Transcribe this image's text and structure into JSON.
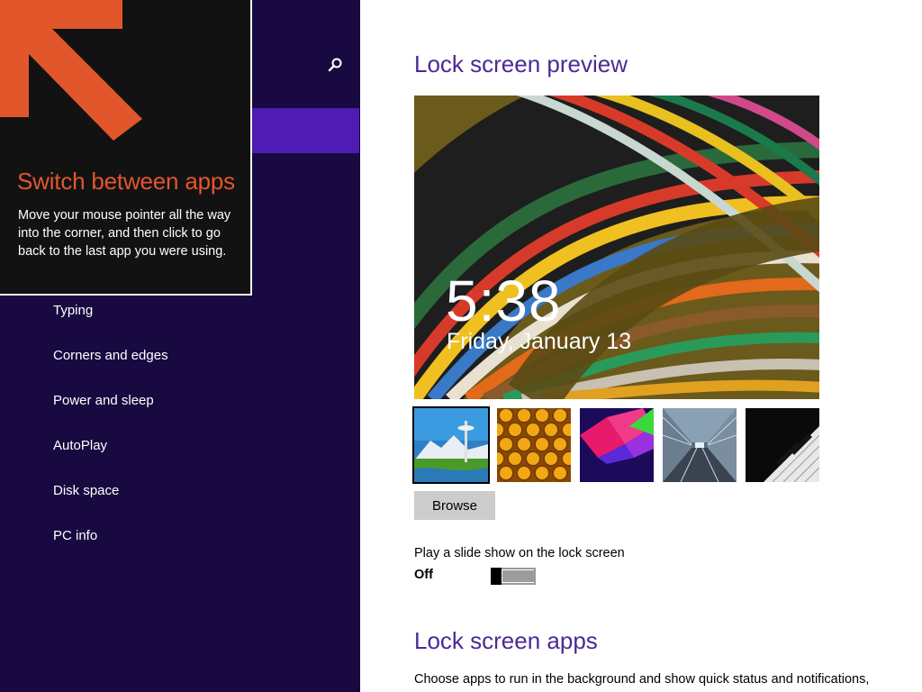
{
  "sidebar": {
    "search_icon": "search-icon",
    "items": [
      {
        "label": "Typing"
      },
      {
        "label": "Corners and edges"
      },
      {
        "label": "Power and sleep"
      },
      {
        "label": "AutoPlay"
      },
      {
        "label": "Disk space"
      },
      {
        "label": "PC info"
      }
    ]
  },
  "tip": {
    "title": "Switch between apps",
    "body": "Move your mouse pointer all the way into the corner, and then click to go back to the last app you were using.",
    "arrow_icon": "arrow-up-left-icon",
    "accent_color": "#e2562c"
  },
  "lock_preview": {
    "title": "Lock screen preview",
    "time": "5:38",
    "date": "Friday, January 13"
  },
  "thumbnails": [
    {
      "name": "space-needle-thumbnail",
      "selected": true
    },
    {
      "name": "honeycomb-thumbnail",
      "selected": false
    },
    {
      "name": "abstract-shapes-thumbnail",
      "selected": false
    },
    {
      "name": "tunnel-thumbnail",
      "selected": false
    },
    {
      "name": "piano-keys-thumbnail",
      "selected": false
    }
  ],
  "browse_label": "Browse",
  "slideshow": {
    "label": "Play a slide show on the lock screen",
    "state": "Off"
  },
  "lock_apps": {
    "title": "Lock screen apps",
    "description": "Choose apps to run in the background and show quick status and notifications,"
  },
  "colors": {
    "sidebar_bg": "#180940",
    "selected_item": "#4e1cb4",
    "heading": "#4b2a96"
  }
}
